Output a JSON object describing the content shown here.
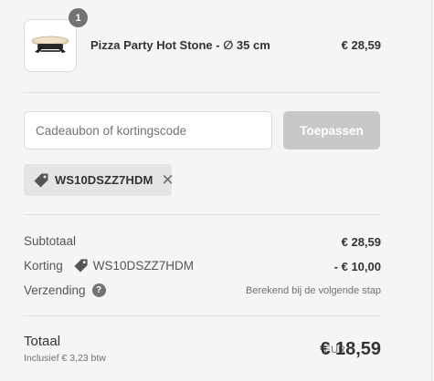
{
  "product": {
    "quantity": "1",
    "name": "Pizza Party Hot Stone - ∅ 35 cm",
    "price": "€ 28,59",
    "image_icon": "pizza-stone-image"
  },
  "discount": {
    "placeholder": "Cadeaubon of kortingscode",
    "apply_label": "Toepassen",
    "applied_code": "WS10DSZZ7HDM",
    "tag_icon": "tag-icon",
    "remove_icon": "close-icon"
  },
  "summary": {
    "subtotal_label": "Subtotaal",
    "subtotal_value": "€ 28,59",
    "discount_label": "Korting",
    "discount_code": "WS10DSZZ7HDM",
    "discount_value": "- € 10,00",
    "shipping_label": "Verzending",
    "shipping_help": "?",
    "shipping_note": "Berekend bij de volgende stap"
  },
  "total": {
    "label": "Totaal",
    "tax_note": "Inclusief € 3,23 btw",
    "currency": "EUR",
    "amount": "€ 18,59"
  },
  "colors": {
    "badge": "#727272",
    "apply_button_disabled": "#c8c8c8",
    "tag_background": "#e4e4e4",
    "background": "#f5f5f5"
  }
}
